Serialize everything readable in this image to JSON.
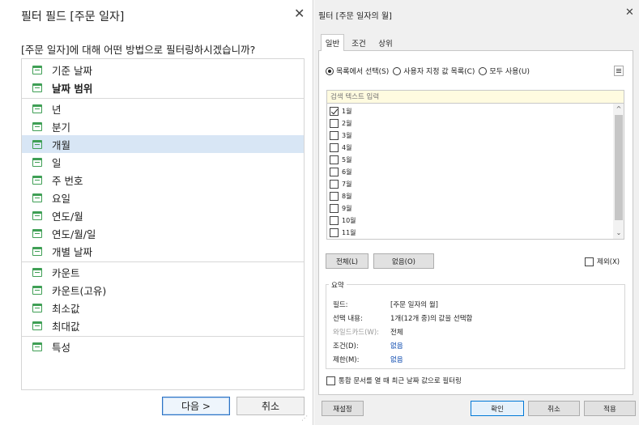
{
  "left_dialog": {
    "title": "필터 필드 [주문 일자]",
    "close_glyph": "✕",
    "question": "[주문 일자]에 대해 어떤 방법으로 필터링하시겠습니까?",
    "items": [
      {
        "label": "기준 날짜"
      },
      {
        "label": "날짜 범위"
      },
      {
        "label": "년"
      },
      {
        "label": "분기"
      },
      {
        "label": "개월"
      },
      {
        "label": "일"
      },
      {
        "label": "주 번호"
      },
      {
        "label": "요일"
      },
      {
        "label": "연도/월"
      },
      {
        "label": "연도/월/일"
      },
      {
        "label": "개별 날짜"
      },
      {
        "label": "카운트"
      },
      {
        "label": "카운트(고유)"
      },
      {
        "label": "최소값"
      },
      {
        "label": "최대값"
      },
      {
        "label": "특성"
      }
    ],
    "next_button": "다음 >",
    "cancel_button": "취소"
  },
  "right_dialog": {
    "title": "필터 [주문 일자의 월]",
    "close_glyph": "✕",
    "tabs": [
      "일반",
      "조건",
      "상위"
    ],
    "radio_options": [
      "목록에서 선택(S)",
      "사용자 지정 값 목록(C)",
      "모두 사용(U)"
    ],
    "search_placeholder": "검색 텍스트 입력",
    "months": [
      {
        "label": "1월",
        "checked": true
      },
      {
        "label": "2월",
        "checked": false
      },
      {
        "label": "3월",
        "checked": false
      },
      {
        "label": "4월",
        "checked": false
      },
      {
        "label": "5월",
        "checked": false
      },
      {
        "label": "6월",
        "checked": false
      },
      {
        "label": "7월",
        "checked": false
      },
      {
        "label": "8월",
        "checked": false
      },
      {
        "label": "9월",
        "checked": false
      },
      {
        "label": "10월",
        "checked": false
      },
      {
        "label": "11월",
        "checked": false
      }
    ],
    "select_all_button": "전체(L)",
    "none_button": "없음(O)",
    "exclude_label": "제외(X)",
    "summary": {
      "legend": "요약",
      "rows": [
        {
          "label": "필드:",
          "value": "[주문 일자의 월]",
          "label_gray": false,
          "value_link": false
        },
        {
          "label": "선택 내용:",
          "value": "1개(12개 중)의 값을 선택함",
          "label_gray": false,
          "value_link": false
        },
        {
          "label": "와일드카드(W):",
          "value": "전체",
          "label_gray": true,
          "value_link": false
        },
        {
          "label": "조건(D):",
          "value": "없음",
          "label_gray": false,
          "value_link": true
        },
        {
          "label": "제한(M):",
          "value": "없음",
          "label_gray": false,
          "value_link": true
        }
      ]
    },
    "bottom_checkbox_label": "통합 문서를 열 때 최근 날짜 값으로 필터링",
    "reset_button": "재설정",
    "ok_button": "확인",
    "cancel_button": "취소",
    "apply_button": "적용"
  },
  "colors": {
    "selected_row": "#d8e6f5",
    "calendar_icon": "#3f9f55",
    "primary_border": "#2c73c5",
    "search_bg": "#fffbe0",
    "link": "#0645ad"
  }
}
